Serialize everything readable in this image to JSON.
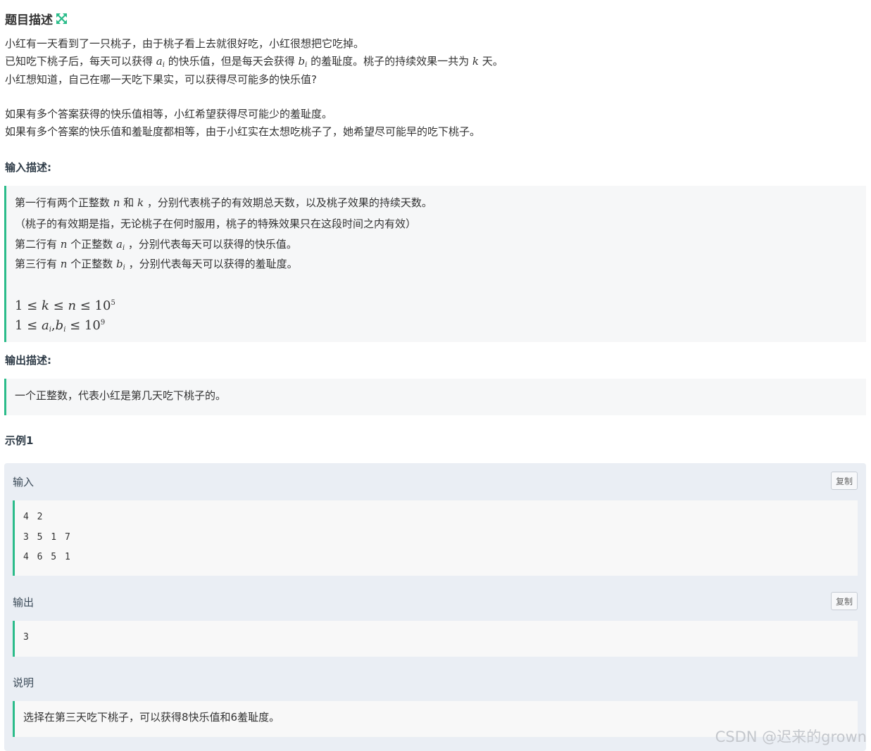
{
  "heading": {
    "title": "题目描述"
  },
  "description": {
    "l1": "小红有一天看到了一只桃子，由于桃子看上去就很好吃，小红很想把它吃掉。",
    "l2_a": "已知吃下桃子后，每天可以获得 ",
    "l2_var_a": "a",
    "l2_sub_i": "i",
    "l2_b": " 的快乐值，但是每天会获得 ",
    "l2_var_b": "b",
    "l2_sub_i2": "i",
    "l2_c": " 的羞耻度。桃子的持续效果一共为 ",
    "l2_var_k": "k",
    "l2_d": " 天。",
    "l3": "小红想知道，自己在哪一天吃下果实，可以获得尽可能多的快乐值?",
    "l4": "如果有多个答案获得的快乐值相等，小红希望获得尽可能少的羞耻度。",
    "l5": "如果有多个答案的快乐值和羞耻度都相等，由于小红实在太想吃桃子了，她希望尽可能早的吃下桃子。"
  },
  "input_section": {
    "heading": "输入描述:",
    "l1_a": "第一行有两个正整数 ",
    "l1_n": "n",
    "l1_b": " 和 ",
    "l1_k": "k",
    "l1_c": " ，分别代表桃子的有效期总天数，以及桃子效果的持续天数。",
    "l2": "（桃子的有效期是指，无论桃子在何时服用，桃子的特殊效果只在这段时间之内有效）",
    "l3_a": "第二行有 ",
    "l3_n": "n",
    "l3_b": " 个正整数 ",
    "l3_var": "a",
    "l3_sub": "i",
    "l3_c": " ，分别代表每天可以获得的快乐值。",
    "l4_a": "第三行有 ",
    "l4_n": "n",
    "l4_b": " 个正整数 ",
    "l4_var": "b",
    "l4_sub": "i",
    "l4_c": " ，分别代表每天可以获得的羞耻度。",
    "c1_left": "1 ≤ ",
    "c1_k": "k",
    "c1_mid": " ≤ ",
    "c1_n": "n",
    "c1_right": " ≤ 10",
    "c1_exp": "5",
    "c2_left": "1 ≤ ",
    "c2_a": "a",
    "c2_sub_a": "i",
    "c2_comma": ",",
    "c2_b": "b",
    "c2_sub_b": "i",
    "c2_right": " ≤ 10",
    "c2_exp": "9"
  },
  "output_section": {
    "heading": "输出描述:",
    "l1": "一个正整数，代表小红是第几天吃下桃子的。"
  },
  "example": {
    "heading": "示例1",
    "input_label": "输入",
    "output_label": "输出",
    "explain_label": "说明",
    "copy_label": "复制",
    "input_lines": [
      "4 2",
      "3 5 1 7",
      "4 6 5 1"
    ],
    "output_lines": [
      "3"
    ],
    "explanation": "选择在第三天吃下桃子，可以获得8快乐值和6羞耻度。"
  },
  "watermark": "CSDN @迟来的grown",
  "colors": {
    "accent": "#2bbc8a",
    "example_bg": "#eaeef4",
    "quote_bg": "#f6f7f8"
  },
  "icons": {
    "expand": "expand-arrows-icon"
  }
}
